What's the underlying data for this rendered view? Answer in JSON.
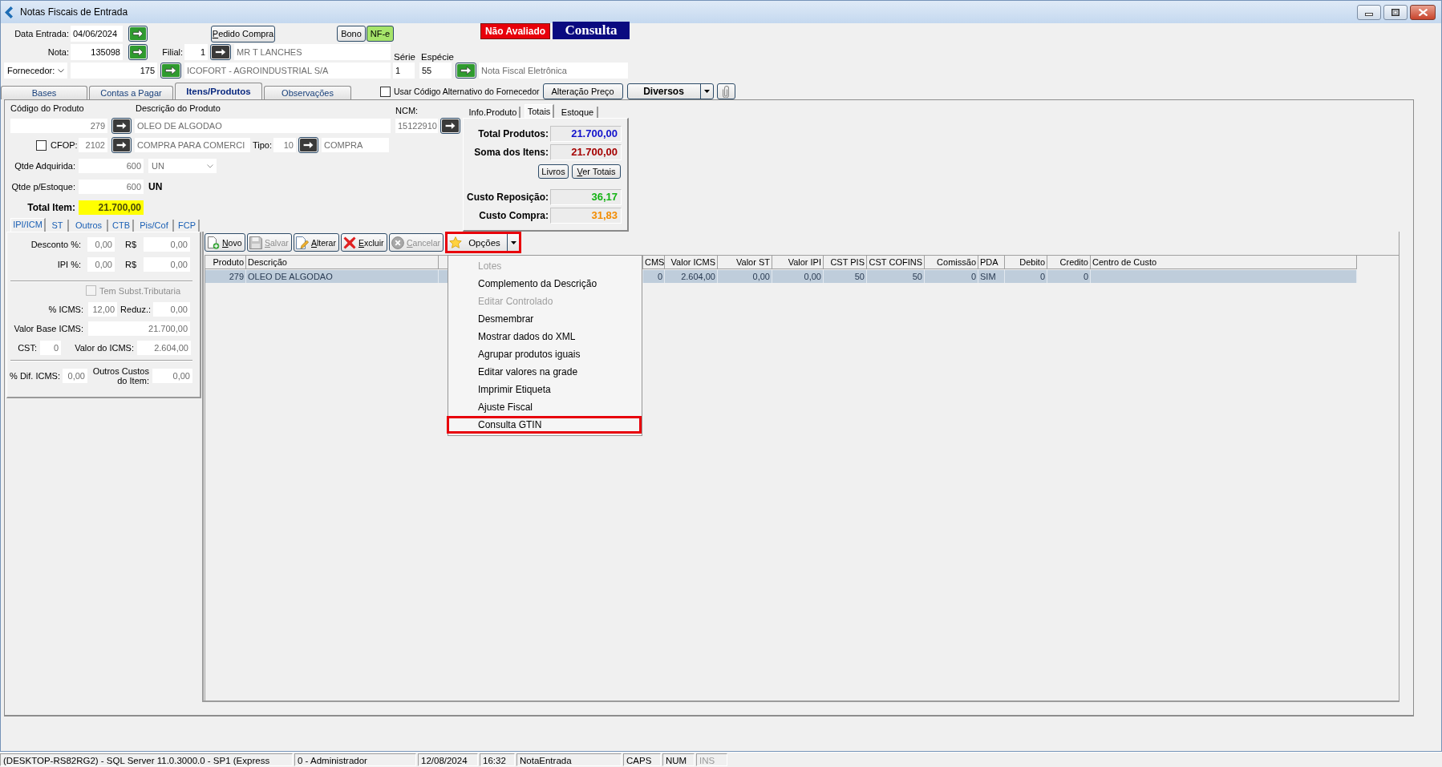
{
  "window": {
    "title": "Notas Fiscais de Entrada"
  },
  "header": {
    "data_entrada": {
      "label": "Data Entrada:",
      "field": {
        "value": "04/06/2024",
        "disabled": false
      },
      "lookup": {
        "disabled": false
      }
    },
    "pedido_compra_button": {
      "label": "Pedido Compra",
      "mnemonic": true
    },
    "bono_button": {
      "label": "Bono"
    },
    "nfe_badge": {
      "label": "NF-e"
    },
    "status_badge": {
      "label": "Não Avaliado"
    },
    "mode_badge": {
      "label": "Consulta"
    },
    "nota": {
      "label": "Nota:",
      "field": {
        "value": "135098",
        "disabled": false
      },
      "lookup": {
        "disabled": false
      }
    },
    "filial": {
      "label": "Filial:",
      "field": {
        "value": "1",
        "disabled": false
      },
      "lookup": {
        "disabled": true
      },
      "name": {
        "value": "MR T LANCHES",
        "disabled": true
      }
    },
    "fornecedor": {
      "selector": "Fornecedor:",
      "field": {
        "value": "175",
        "disabled": false
      },
      "lookup": {
        "disabled": false
      },
      "name": {
        "value": "ICOFORT - AGROINDUSTRIAL S/A",
        "disabled": true
      }
    },
    "serie": {
      "label": "Série",
      "field": {
        "value": "1",
        "disabled": false
      }
    },
    "especie": {
      "label": "Espécie",
      "field": {
        "value": "55",
        "disabled": false
      },
      "lookup": {
        "disabled": false
      },
      "name": {
        "value": "Nota Fiscal Eletrônica",
        "disabled": true
      }
    }
  },
  "tabs": [
    {
      "label": "Bases",
      "selected": false
    },
    {
      "label": "Contas a Pagar",
      "selected": false
    },
    {
      "label": "Itens/Produtos",
      "selected": true
    },
    {
      "label": "Observações",
      "selected": false
    }
  ],
  "tab_bar_controls": {
    "alt_code_checkbox": {
      "label": "Usar Código Alternativo do Fornecedor",
      "checked": false
    },
    "price_button": {
      "label": "Alteração Preço"
    },
    "misc_dropdown": {
      "label": "Diversos"
    }
  },
  "product": {
    "codigo": {
      "label": "Código do Produto",
      "field": {
        "value": "279",
        "disabled": true
      },
      "lookup": {
        "disabled": true
      }
    },
    "descricao": {
      "label": "Descrição do Produto",
      "field": {
        "value": "OLEO DE ALGODAO",
        "disabled": true
      }
    },
    "ncm": {
      "label": "NCM:",
      "field": {
        "value": "15122910",
        "disabled": true
      },
      "lookup": {
        "disabled": true
      }
    },
    "cfop": {
      "checked": false,
      "label": "CFOP:",
      "field": {
        "value": "2102",
        "disabled": true
      },
      "lookup": {
        "disabled": true
      },
      "description": {
        "value": "COMPRA PARA COMERCI",
        "disabled": true
      }
    },
    "tipo": {
      "label": "Tipo:",
      "field": {
        "value": "10",
        "disabled": true
      },
      "lookup": {
        "disabled": true
      },
      "description": {
        "value": "COMPRA",
        "disabled": true
      }
    },
    "qtde_adquirida": {
      "label": "Qtde Adquirida:",
      "field": {
        "value": "600",
        "disabled": true
      },
      "unit_select": {
        "value": "UN",
        "disabled": true
      }
    },
    "qtde_estoque": {
      "label": "Qtde p/Estoque:",
      "field": {
        "value": "600",
        "disabled": true
      },
      "unit": "UN"
    },
    "total_item": {
      "label": "Total Item:",
      "value": "21.700,00"
    }
  },
  "totals": {
    "tabs": [
      {
        "label": "Info.Produto",
        "selected": false
      },
      {
        "label": "Totais",
        "selected": true
      },
      {
        "label": "Estoque",
        "selected": false
      }
    ],
    "sums": [
      {
        "label": "Total Produtos:",
        "value": "21.700,00",
        "color": "#1111cc"
      },
      {
        "label": "Soma dos Itens:",
        "value": "21.700,00",
        "color": "#a50000"
      }
    ],
    "buttons": [
      {
        "label": "Livros",
        "mnemonic": false
      },
      {
        "label": "Ver Totais",
        "mnemonic": true
      }
    ],
    "costs": [
      {
        "label": "Custo Reposição:",
        "value": "36,17",
        "color": "#14b314"
      },
      {
        "label": "Custo Compra:",
        "value": "31,83",
        "color": "#f28c00"
      }
    ]
  },
  "tax": {
    "tabs": [
      {
        "label": "IPI/ICM",
        "selected": true
      },
      {
        "label": "ST",
        "selected": false
      },
      {
        "label": "Outros",
        "selected": false
      },
      {
        "label": "CTB",
        "selected": false
      },
      {
        "label": "Pis/Cof",
        "selected": false
      },
      {
        "label": "FCP",
        "selected": false
      }
    ],
    "desconto": {
      "label": "Desconto %:",
      "percent": {
        "value": "0,00",
        "disabled": true
      },
      "currency_label": "R$",
      "amount": {
        "value": "0,00",
        "disabled": true
      }
    },
    "ipi": {
      "label": "IPI %:",
      "percent": {
        "value": "0,00",
        "disabled": true
      },
      "currency_label": "R$",
      "amount": {
        "value": "0,00",
        "disabled": true
      }
    },
    "subst_tributaria": {
      "label": "Tem Subst.Tributaria",
      "checked": false,
      "disabled": true
    },
    "icms": {
      "label": "% ICMS:",
      "field": {
        "value": "12,00",
        "disabled": true
      },
      "reducao_label": "Reduz.:",
      "reducao": {
        "value": "0,00",
        "disabled": true
      }
    },
    "base_icms": {
      "label": "Valor Base ICMS:",
      "field": {
        "value": "21.700,00",
        "disabled": true
      }
    },
    "cst": {
      "label": "CST:",
      "field": {
        "value": "0",
        "disabled": true
      },
      "valor_label": "Valor do ICMS:",
      "valor": {
        "value": "2.604,00",
        "disabled": true
      }
    },
    "dif_icms": {
      "label": "% Dif. ICMS:",
      "field": {
        "value": "0,00",
        "disabled": true
      },
      "outros_label": "Outros Custos do Item:",
      "outros": {
        "value": "0,00",
        "disabled": true
      }
    }
  },
  "item_toolbar": [
    {
      "kind": "new",
      "label": "Novo",
      "mnemonic": true,
      "disabled": false,
      "highlighted": false
    },
    {
      "kind": "save",
      "label": "Salvar",
      "mnemonic": true,
      "disabled": true,
      "highlighted": false
    },
    {
      "kind": "edit",
      "label": "Alterar",
      "mnemonic": true,
      "disabled": false,
      "highlighted": false
    },
    {
      "kind": "delete",
      "label": "Excluir",
      "mnemonic": true,
      "disabled": false,
      "highlighted": false
    },
    {
      "kind": "cancel",
      "label": "Cancelar",
      "mnemonic": true,
      "disabled": true,
      "highlighted": false
    },
    {
      "kind": "options",
      "label": "Opções",
      "mnemonic": false,
      "disabled": false,
      "highlighted": true
    }
  ],
  "options_menu": [
    {
      "label": "Lotes",
      "disabled": true,
      "highlighted": false
    },
    {
      "label": "Complemento da Descrição",
      "disabled": false,
      "highlighted": false
    },
    {
      "label": "Editar Controlado",
      "disabled": true,
      "highlighted": false
    },
    {
      "label": "Desmembrar",
      "disabled": false,
      "highlighted": false
    },
    {
      "label": "Mostrar dados do XML",
      "disabled": false,
      "highlighted": false
    },
    {
      "label": "Agrupar produtos iguais",
      "disabled": false,
      "highlighted": false
    },
    {
      "label": "Editar valores na grade",
      "disabled": false,
      "highlighted": false
    },
    {
      "label": "Imprimir Etiqueta",
      "disabled": false,
      "highlighted": false
    },
    {
      "label": "Ajuste Fiscal",
      "disabled": false,
      "highlighted": false
    },
    {
      "label": "Consulta GTIN",
      "disabled": false,
      "highlighted": true
    }
  ],
  "grid": {
    "columns": [
      "Produto",
      "Descrição",
      "CMS",
      "Valor ICMS",
      "Valor ST",
      "Valor IPI",
      "CST PIS",
      "CST COFINS",
      "Comissão",
      "PDA",
      "Debito",
      "Credito",
      "Centro de Custo"
    ],
    "rows": [
      {
        "selected": true,
        "cells": [
          "279",
          "OLEO DE ALGODAO",
          "0",
          "2.604,00",
          "0,00",
          "0,00",
          "50",
          "50",
          "0",
          "SIM",
          "0",
          "0"
        ]
      }
    ]
  },
  "status_bar": [
    {
      "text": "(DESKTOP-RS82RG2) - SQL Server 11.0.3000.0 - SP1 (Express",
      "disabled": false
    },
    {
      "text": "0 - Administrador",
      "disabled": false
    },
    {
      "text": "12/08/2024",
      "disabled": false
    },
    {
      "text": "16:32",
      "disabled": false
    },
    {
      "text": "NotaEntrada",
      "disabled": false
    },
    {
      "text": "CAPS",
      "disabled": false
    },
    {
      "text": "NUM",
      "disabled": false
    },
    {
      "text": "INS",
      "disabled": true
    }
  ]
}
